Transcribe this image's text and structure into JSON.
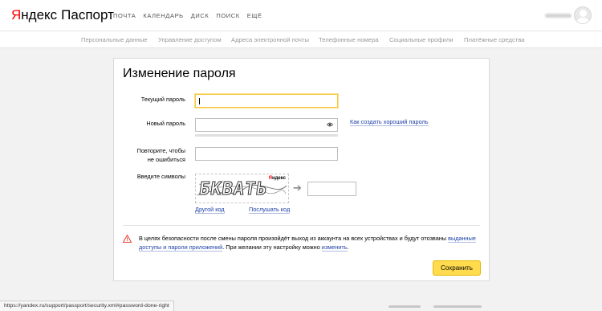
{
  "header": {
    "logo": {
      "brand_red": "Я",
      "brand_rest": "ндекс",
      "product": "Паспорт"
    },
    "nav": [
      {
        "label": "ПОЧТА"
      },
      {
        "label": "КАЛЕНДАРЬ"
      },
      {
        "label": "ДИСК"
      },
      {
        "label": "ПОИСК"
      },
      {
        "label": "ЕЩЁ"
      }
    ],
    "avatar_icon": "user-avatar-icon"
  },
  "subnav": [
    {
      "label": "Персональные данные"
    },
    {
      "label": "Управление доступом"
    },
    {
      "label": "Адреса электронной почты"
    },
    {
      "label": "Телефонные номера"
    },
    {
      "label": "Социальные профили"
    },
    {
      "label": "Платёжные средства"
    }
  ],
  "form": {
    "title": "Изменение пароля",
    "current_password": {
      "label": "Текущий пароль",
      "value": ""
    },
    "new_password": {
      "label": "Новый пароль",
      "value": "",
      "eye_icon": "eye-icon"
    },
    "repeat_password": {
      "label_line1": "Повторите, чтобы",
      "label_line2": "не ошибиться",
      "value": ""
    },
    "captcha": {
      "label": "Введите символы",
      "image_text": "БКВАТЬ",
      "brand_red": "Я",
      "brand_rest": "ндекс",
      "value": "",
      "arrow_icon": "arrow-right-icon",
      "other_code": "Другой код",
      "listen_code": "Послушать код"
    },
    "help_link": "Как создать хороший пароль"
  },
  "warning": {
    "icon": "warning-triangle-icon",
    "text_1": "В целях безопасности после смены пароля произойдёт выход из аккаунта на всех устройствах и будут отозваны ",
    "link_1": "выданные доступы и пароли приложений",
    "text_2": ". При желании эту настройку можно ",
    "link_2": "изменить",
    "text_3": "."
  },
  "save_button": "Сохранить",
  "status_url": "https://yandex.ru/support/passport/security.xml#password-done-right",
  "colors": {
    "accent_yellow": "#ffdb4d",
    "link_blue": "#1c3fa5",
    "warning_red": "#e8443a",
    "logo_red": "#ff0000",
    "focus_yellow": "#f5c73d"
  }
}
